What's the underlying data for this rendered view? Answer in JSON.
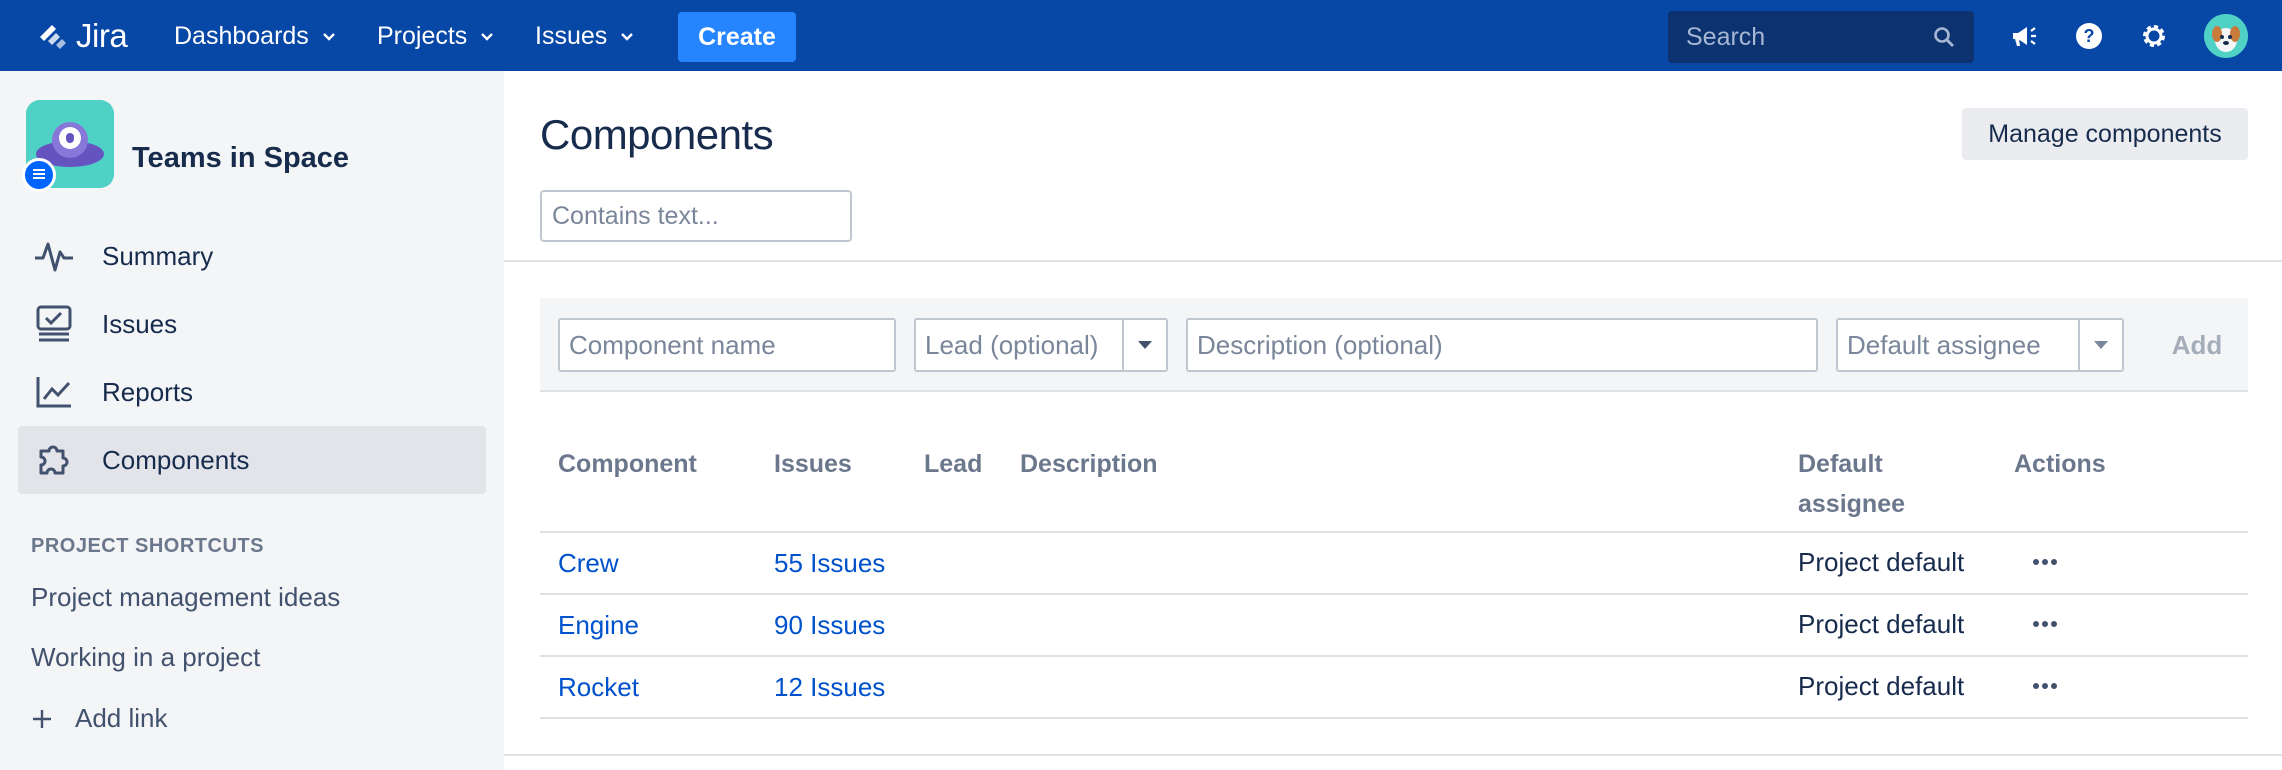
{
  "topnav": {
    "logo_text": "Jira",
    "menus": [
      {
        "label": "Dashboards"
      },
      {
        "label": "Projects"
      },
      {
        "label": "Issues"
      }
    ],
    "create_label": "Create",
    "search_placeholder": "Search",
    "icons": [
      "notifications-icon",
      "help-icon",
      "settings-icon",
      "profile-avatar"
    ]
  },
  "sidebar": {
    "project_name": "Teams in Space",
    "items": [
      {
        "label": "Summary",
        "icon": "activity-icon"
      },
      {
        "label": "Issues",
        "icon": "issues-icon"
      },
      {
        "label": "Reports",
        "icon": "chart-icon"
      },
      {
        "label": "Components",
        "icon": "puzzle-icon",
        "active": true
      }
    ],
    "shortcuts_title": "PROJECT SHORTCUTS",
    "shortcuts": [
      {
        "label": "Project management ideas"
      },
      {
        "label": "Working in a project"
      }
    ],
    "add_link_label": "Add link"
  },
  "main": {
    "title": "Components",
    "manage_button": "Manage components",
    "filter_placeholder": "Contains text...",
    "add_form": {
      "name_placeholder": "Component name",
      "lead_placeholder": "Lead (optional)",
      "description_placeholder": "Description (optional)",
      "assignee_placeholder": "Default assignee",
      "add_label": "Add"
    },
    "table": {
      "headers": {
        "component": "Component",
        "issues": "Issues",
        "lead": "Lead",
        "description": "Description",
        "default_assignee_1": "Default",
        "default_assignee_2": "assignee",
        "actions": "Actions"
      },
      "rows": [
        {
          "component": "Crew",
          "issues": "55 Issues",
          "lead": "",
          "description": "",
          "assignee": "Project default"
        },
        {
          "component": "Engine",
          "issues": "90 Issues",
          "lead": "",
          "description": "",
          "assignee": "Project default"
        },
        {
          "component": "Rocket",
          "issues": "12 Issues",
          "lead": "",
          "description": "",
          "assignee": "Project default"
        }
      ]
    }
  },
  "colors": {
    "nav_bg": "#0747a6",
    "create_bg": "#2684ff",
    "search_bg": "#0c3370",
    "sidebar_bg": "#f4f5f7",
    "link": "#0052cc",
    "text": "#172b4d"
  }
}
